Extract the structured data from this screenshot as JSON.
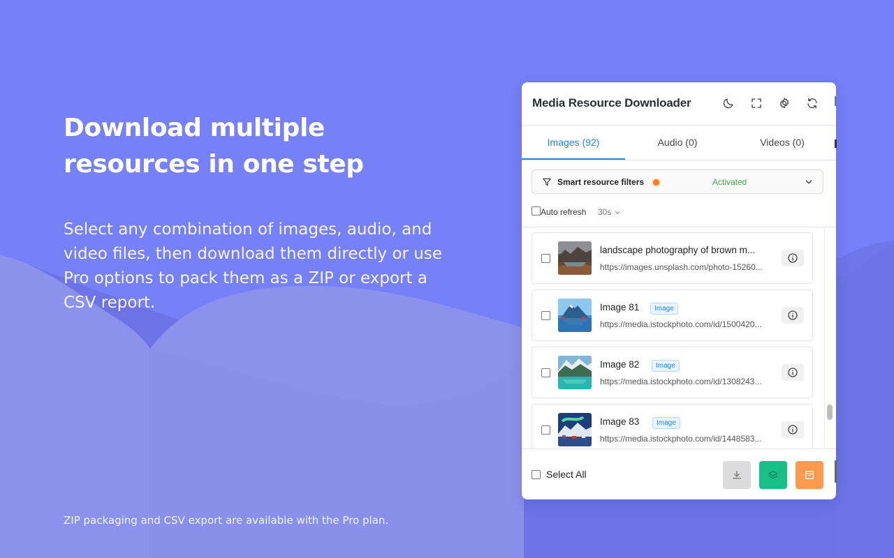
{
  "hero": {
    "title": "Download multiple resources in one step",
    "description": "Select any combination of images, audio, and video files, then download them directly or use Pro options to pack them as a ZIP or export a CSV report.",
    "footnote": "ZIP packaging and CSV export are available with the Pro plan."
  },
  "panel": {
    "title": "Media Resource Downloader",
    "header_icons": [
      "moon-icon",
      "fullscreen-icon",
      "gear-icon",
      "refresh-icon"
    ],
    "tabs": [
      {
        "label": "Images (92)",
        "active": true
      },
      {
        "label": "Audio (0)",
        "active": false
      },
      {
        "label": "Videos (0)",
        "active": false
      }
    ],
    "filter": {
      "label": "Smart resource filters",
      "status": "Activated"
    },
    "auto_refresh": {
      "label": "Auto refresh",
      "interval": "30s",
      "checked": false
    },
    "items": [
      {
        "name": "landscape photography of brown m...",
        "badge": "",
        "url": "https://images.unsplash.com/photo-15260...",
        "thumb": "mountain-lake-photo"
      },
      {
        "name": "Image 81",
        "badge": "Image",
        "url": "https://media.istockphoto.com/id/1500420...",
        "thumb": "blue-mountain-photo"
      },
      {
        "name": "Image 82",
        "badge": "Image",
        "url": "https://media.istockphoto.com/id/1308243...",
        "thumb": "turquoise-lake-photo"
      },
      {
        "name": "Image 83",
        "badge": "Image",
        "url": "https://media.istockphoto.com/id/1448583...",
        "thumb": "aurora-village-photo"
      }
    ],
    "footer": {
      "select_all_label": "Select All",
      "buttons": [
        {
          "icon": "download-icon",
          "color": "#dcdcdc"
        },
        {
          "icon": "layers-icon",
          "color": "#18bf86"
        },
        {
          "icon": "archive-icon",
          "color": "#fd9a4c"
        }
      ]
    }
  },
  "colors": {
    "background": "#7680f7",
    "accent": "#1d87e4",
    "active_status": "#3aa54b",
    "filter_dot": "#fa7d1a"
  }
}
